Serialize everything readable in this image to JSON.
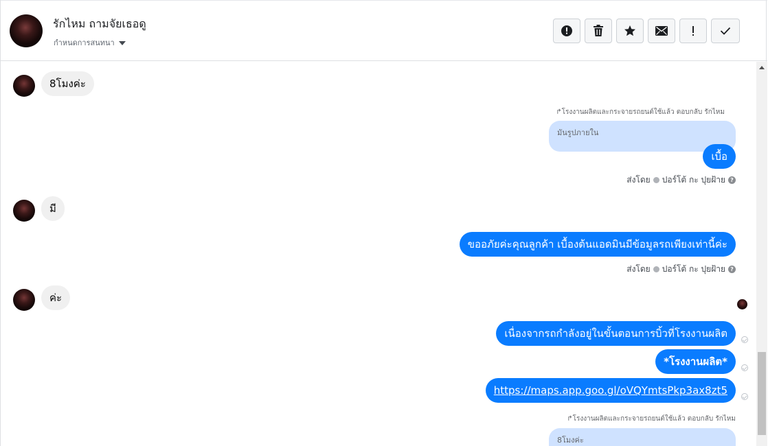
{
  "header": {
    "contact_name": "รักไหม ถามจัยเธอดู",
    "assign_label": "กำหนดการสนทนา",
    "toolbar": [
      {
        "name": "report-spam-button",
        "icon": "alert-circle-icon"
      },
      {
        "name": "delete-button",
        "icon": "trash-icon"
      },
      {
        "name": "star-button",
        "icon": "star-icon"
      },
      {
        "name": "mark-unread-button",
        "icon": "envelope-icon"
      },
      {
        "name": "follow-up-button",
        "icon": "exclamation-icon"
      },
      {
        "name": "mark-done-button",
        "icon": "check-icon"
      }
    ]
  },
  "messages": {
    "m1": "8โมงค่ะ",
    "reply1_note": "↱โรงงานผลิตและกระจายรถยนต์ใช้แล้ว ตอบกลับ รักไหม",
    "reply1_quote": "มันรูปภายใน",
    "m2": "เบื้อ",
    "sent_by_1": "ส่งโดย",
    "sender_1": "ปอร์โต้ กะ ปุยฝ้าย",
    "m3": "มี",
    "m4": "ขออภัยค่ะคุณลูกค้า เบื้องต้นแอดมินมีข้อมูลรถเพียงเท่านี้ค่ะ",
    "sent_by_2": "ส่งโดย",
    "sender_2": "ปอร์โต้ กะ ปุยฝ้าย",
    "m5": "ค่ะ",
    "m6": "เนื่องจากรถกำลังอยู่ในขั้นตอนการบิ้วที่โรงงานผลิต",
    "m7": "*โรงงานผลิต*",
    "m8": "https://maps.app.goo.gl/oVQYmtsPkp3ax8zt5",
    "reply2_note": "↱โรงงานผลิตและกระจายรถยนต์ใช้แล้ว ตอบกลับ รักไหม",
    "reply2_quote": "8โมงค่ะ"
  },
  "colors": {
    "outgoing_bubble": "#0a7cff",
    "incoming_bubble": "#f0f0f0",
    "reply_quote": "#cfe2ff"
  }
}
